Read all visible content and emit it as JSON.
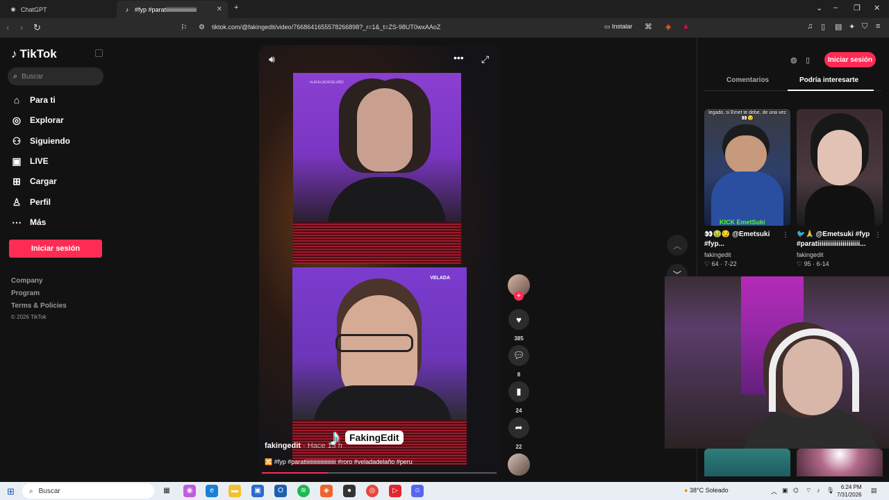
{
  "browser": {
    "tabs": [
      {
        "title": "ChatGPT",
        "active": false
      },
      {
        "title": "#fyp #paratiiiiiiiiiiiiiiiiiiiiii",
        "active": true
      }
    ],
    "url": "tiktok.com/@fakingedit/video/7668641655578266898?_r=1&_t=ZS-98UT0wxAAoZ",
    "install_label": "Instalar"
  },
  "tiktok": {
    "logo": "TikTok",
    "search_placeholder": "Buscar",
    "nav": [
      {
        "label": "Para ti",
        "icon": "home-icon"
      },
      {
        "label": "Explorar",
        "icon": "compass-icon"
      },
      {
        "label": "Siguiendo",
        "icon": "following-icon"
      },
      {
        "label": "LIVE",
        "icon": "live-icon"
      },
      {
        "label": "Cargar",
        "icon": "upload-icon"
      },
      {
        "label": "Perfil",
        "icon": "profile-icon"
      },
      {
        "label": "Más",
        "icon": "more-icon"
      }
    ],
    "login_label": "Iniciar sesión",
    "footer": [
      "Company",
      "Program",
      "Terms & Policies",
      "© 2026 TikTok"
    ]
  },
  "video": {
    "author": "fakingedit",
    "posted": "· Hace 13 h",
    "caption": "🔀 #fyp #paratiiiiiiiiiiiiiiiiiiiiii #roro #veladadelaño #peru",
    "watermark": "FakingEdit",
    "top_tag": "#LAVELADADELAÑO",
    "bottom_logo": "VELADA",
    "progress": 0.28,
    "likes": "385",
    "comments": "8",
    "saves": "24",
    "shares": "22"
  },
  "right_panel": {
    "login_label": "Iniciar sesión",
    "tabs": [
      "Comentarios",
      "Podría interesarte"
    ],
    "active_tab": 1,
    "cards": [
      {
        "overlay_text": "legado, si Emet te debe, de una vez 👀😏",
        "bottom_overlay": "KICK EmetSuki",
        "title": "👀🤢😏 @Emetsuki #fyp...",
        "author": "fakingedit",
        "likes": "♡ 64",
        "date": "7-22"
      },
      {
        "overlay_text": "",
        "bottom_overlay": "",
        "title": "🐦🙏 @Emetsuki #fyp #paratiiiiiiiiiiiiiiiiiiiiii...",
        "author": "fakingedit",
        "likes": "♡ 95",
        "date": "6-14"
      }
    ]
  },
  "taskbar": {
    "search_placeholder": "Buscar",
    "weather": "38°C  Soleado",
    "time": "6:24 PM",
    "date": "7/31/2026"
  },
  "colors": {
    "accent": "#fe2c55",
    "background": "#121212"
  }
}
